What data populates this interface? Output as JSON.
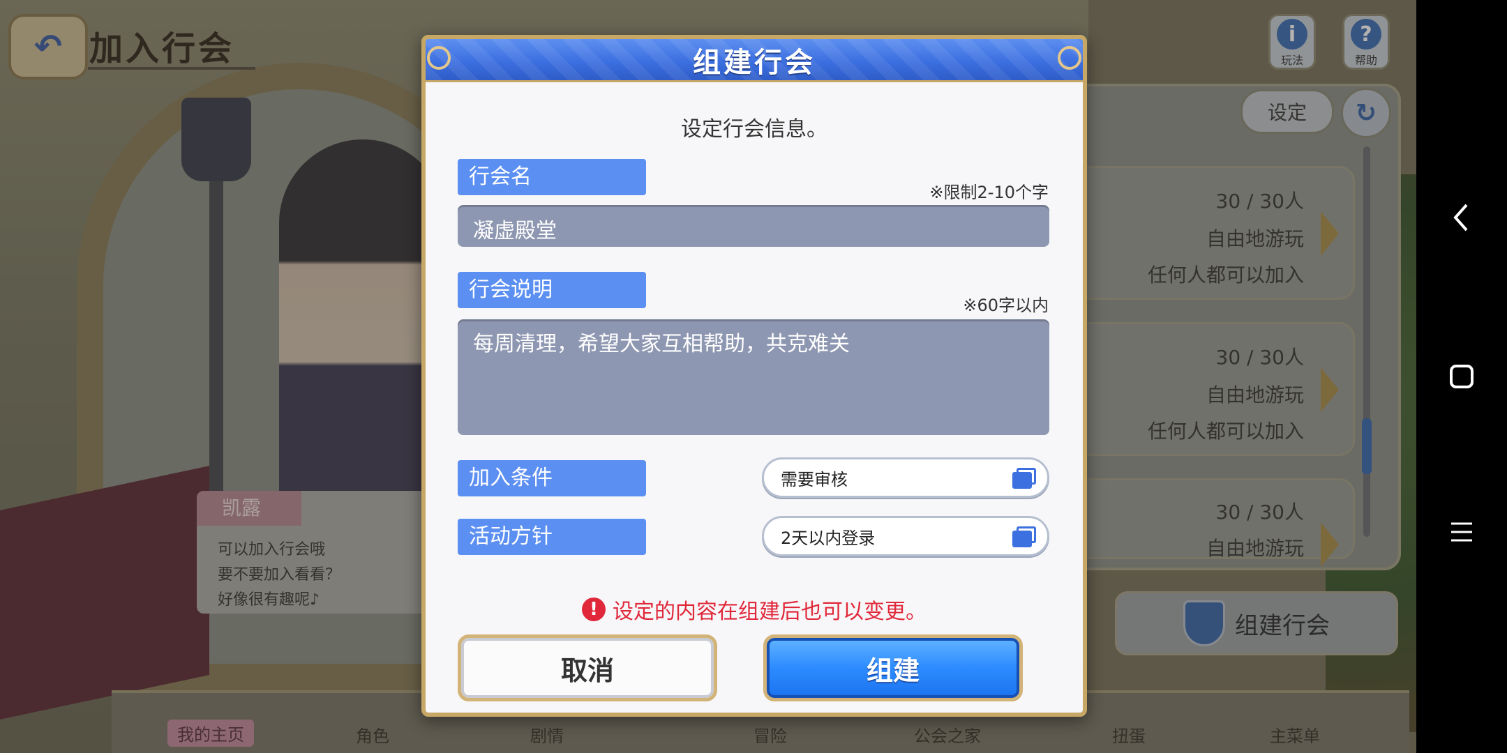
{
  "page": {
    "title": "加入行会",
    "back_icon": "back-arrow-icon"
  },
  "top_right": {
    "info_label": "玩法",
    "help_label": "帮助"
  },
  "background_guild_list": {
    "settings_label": "设定",
    "cards": [
      {
        "members": "30 / 30人",
        "policy": "自由地游玩",
        "condition": "任何人都可以加入"
      },
      {
        "members": "30 / 30人",
        "policy": "自由地游玩",
        "condition": "任何人都可以加入"
      },
      {
        "members": "30 / 30人",
        "policy": "自由地游玩"
      }
    ],
    "create_guild_label": "组建行会"
  },
  "speech_bubble": {
    "speaker": "凯露",
    "lines": [
      "可以加入行会哦",
      "要不要加入看看？",
      "好像很有趣呢♪"
    ]
  },
  "bottom_nav": [
    "我的主页",
    "角色",
    "剧情",
    "冒险",
    "公会之家",
    "扭蛋",
    "主菜单"
  ],
  "dialog": {
    "title": "组建行会",
    "instruction": "设定行会信息。",
    "guild_name": {
      "label": "行会名",
      "note": "※限制2-10个字",
      "value": "凝虚殿堂"
    },
    "guild_description": {
      "label": "行会说明",
      "note": "※60字以内",
      "value": "每周清理，希望大家互相帮助，共克难关"
    },
    "join_condition": {
      "label": "加入条件",
      "value": "需要审核"
    },
    "activity_policy": {
      "label": "活动方针",
      "value": "2天以内登录"
    },
    "notice": "设定的内容在组建后也可以变更。",
    "cancel_label": "取消",
    "create_label": "组建"
  },
  "colors": {
    "header_blue": "#3c6fe0",
    "label_blue": "#5b8ff1",
    "gold_border": "#c7a766",
    "warning_red": "#e0283a",
    "input_bg": "#8e97b1"
  }
}
